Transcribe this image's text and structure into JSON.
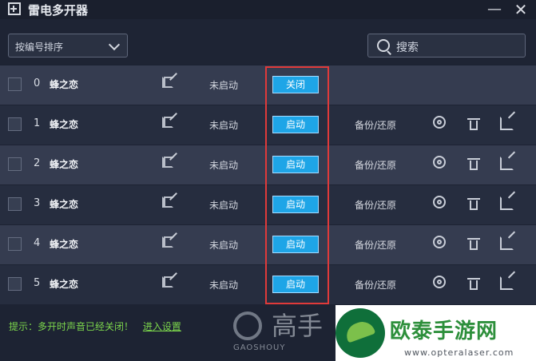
{
  "window": {
    "title": "雷电多开器",
    "minimize": "—",
    "close": "✕"
  },
  "toolbar": {
    "sort_label": "按编号排序",
    "search_placeholder": "搜索"
  },
  "rows": [
    {
      "index": "0",
      "name": "蜂之恋",
      "status": "未启动",
      "action": "关闭",
      "backup": ""
    },
    {
      "index": "1",
      "name": "蜂之恋",
      "status": "未启动",
      "action": "启动",
      "backup": "备份/还原"
    },
    {
      "index": "2",
      "name": "蜂之恋",
      "status": "未启动",
      "action": "启动",
      "backup": "备份/还原"
    },
    {
      "index": "3",
      "name": "蜂之恋",
      "status": "未启动",
      "action": "启动",
      "backup": "备份/还原"
    },
    {
      "index": "4",
      "name": "蜂之恋",
      "status": "未启动",
      "action": "启动",
      "backup": "备份/还原"
    },
    {
      "index": "5",
      "name": "蜂之恋",
      "status": "未启动",
      "action": "启动",
      "backup": "备份/还原"
    }
  ],
  "footer": {
    "tip": "提示：多开时声音已经关闭！",
    "link": "进入设置"
  },
  "watermark": {
    "text": "高手",
    "sub": "GAOSHOUY"
  },
  "brand": {
    "name": "欧泰手游网",
    "url": "www.opteralaser.com"
  },
  "colors": {
    "accent": "#1ea5e7",
    "highlight": "#e03a3a",
    "tip": "#7cd64c"
  }
}
